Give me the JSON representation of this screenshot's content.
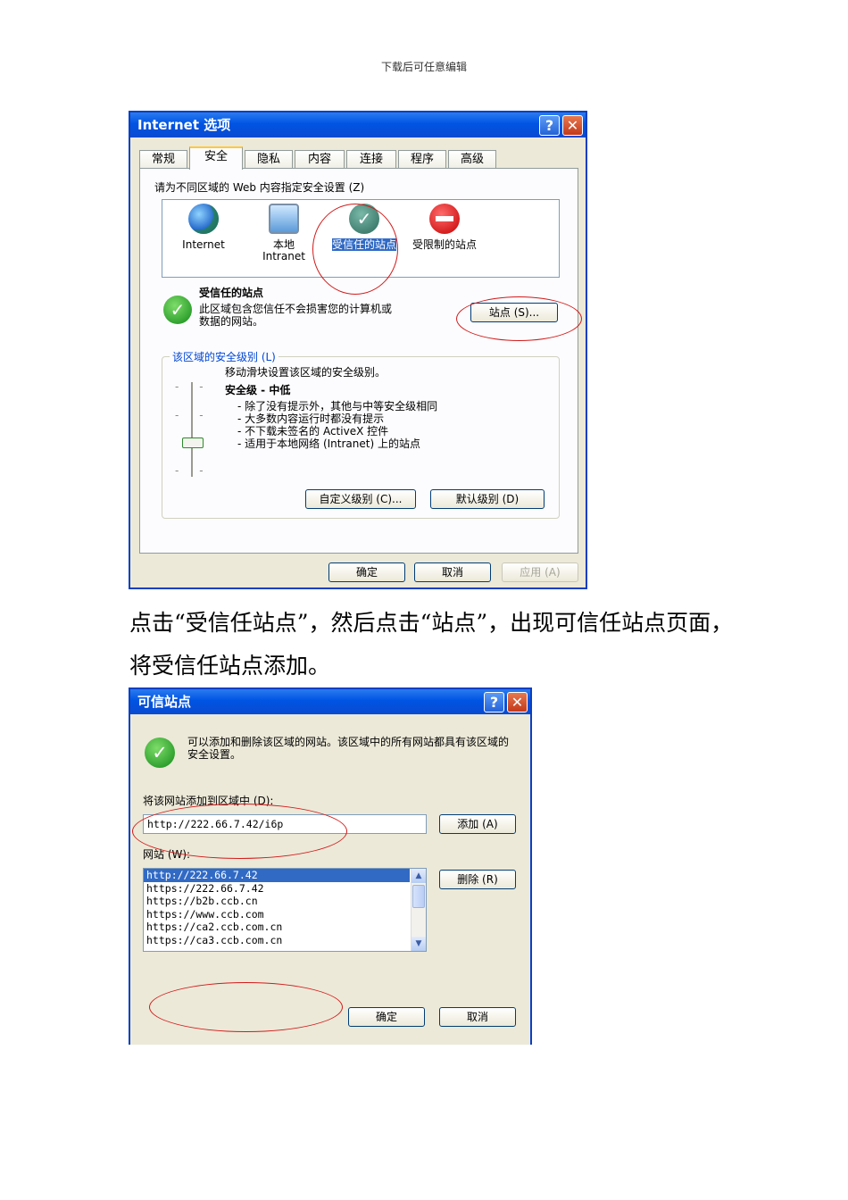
{
  "header": {
    "text": "下载后可任意编辑"
  },
  "dialog1": {
    "title": "Internet 选项",
    "help_glyph": "?",
    "close_glyph": "✕",
    "tabs": [
      "常规",
      "安全",
      "隐私",
      "内容",
      "连接",
      "程序",
      "高级"
    ],
    "active_tab": "安全",
    "zone_prompt": "请为不同区域的 Web 内容指定安全设置 (Z)",
    "zones": [
      {
        "label": "Internet",
        "icon": "globe-icon"
      },
      {
        "label": "本地\nIntranet",
        "icon": "intranet-icon"
      },
      {
        "label": "受信任的站点",
        "icon": "trusted-check-icon"
      },
      {
        "label": "受限制的站点",
        "icon": "restricted-icon"
      }
    ],
    "zone_heading": "受信任的站点",
    "zone_desc": "此区域包含您信任不会损害您的计算机或数据的网站。",
    "sites_button": "站点 (S)...",
    "group_title": "该区域的安全级别 (L)",
    "slider_hint": "移动滑块设置该区域的安全级别。",
    "level_title": "安全级 - 中低",
    "level_bullets": [
      "- 除了没有提示外，其他与中等安全级相同",
      "- 大多数内容运行时都没有提示",
      "- 不下载未签名的 ActiveX 控件",
      "- 适用于本地网络 (Intranet) 上的站点"
    ],
    "custom_button": "自定义级别 (C)...",
    "default_button": "默认级别 (D)",
    "ok_button": "确定",
    "cancel_button": "取消",
    "apply_button": "应用 (A)"
  },
  "paragraph": "点击“受信任站点”，然后点击“站点”，出现可信任站点页面，将受信任站点添加。",
  "dialog2": {
    "title": "可信站点",
    "help_glyph": "?",
    "close_glyph": "✕",
    "info_text": "可以添加和删除该区域的网站。该区域中的所有网站都具有该区域的安全设置。",
    "add_label": "将该网站添加到区域中 (D):",
    "add_value": "http://222.66.7.42/i6p",
    "add_button": "添加 (A)",
    "websites_label": "网站 (W):",
    "websites": [
      "http://222.66.7.42",
      "https://222.66.7.42",
      "https://b2b.ccb.cn",
      "https://www.ccb.com",
      "https://ca2.ccb.com.cn",
      "https://ca3.ccb.com.cn"
    ],
    "remove_button": "删除 (R)",
    "ok_button": "确定",
    "cancel_button": "取消"
  },
  "colors": {
    "title_blue": "#0054e3",
    "annotation_red": "#d21a1a",
    "xp_face": "#ece9d8",
    "selection": "#316ac5"
  }
}
